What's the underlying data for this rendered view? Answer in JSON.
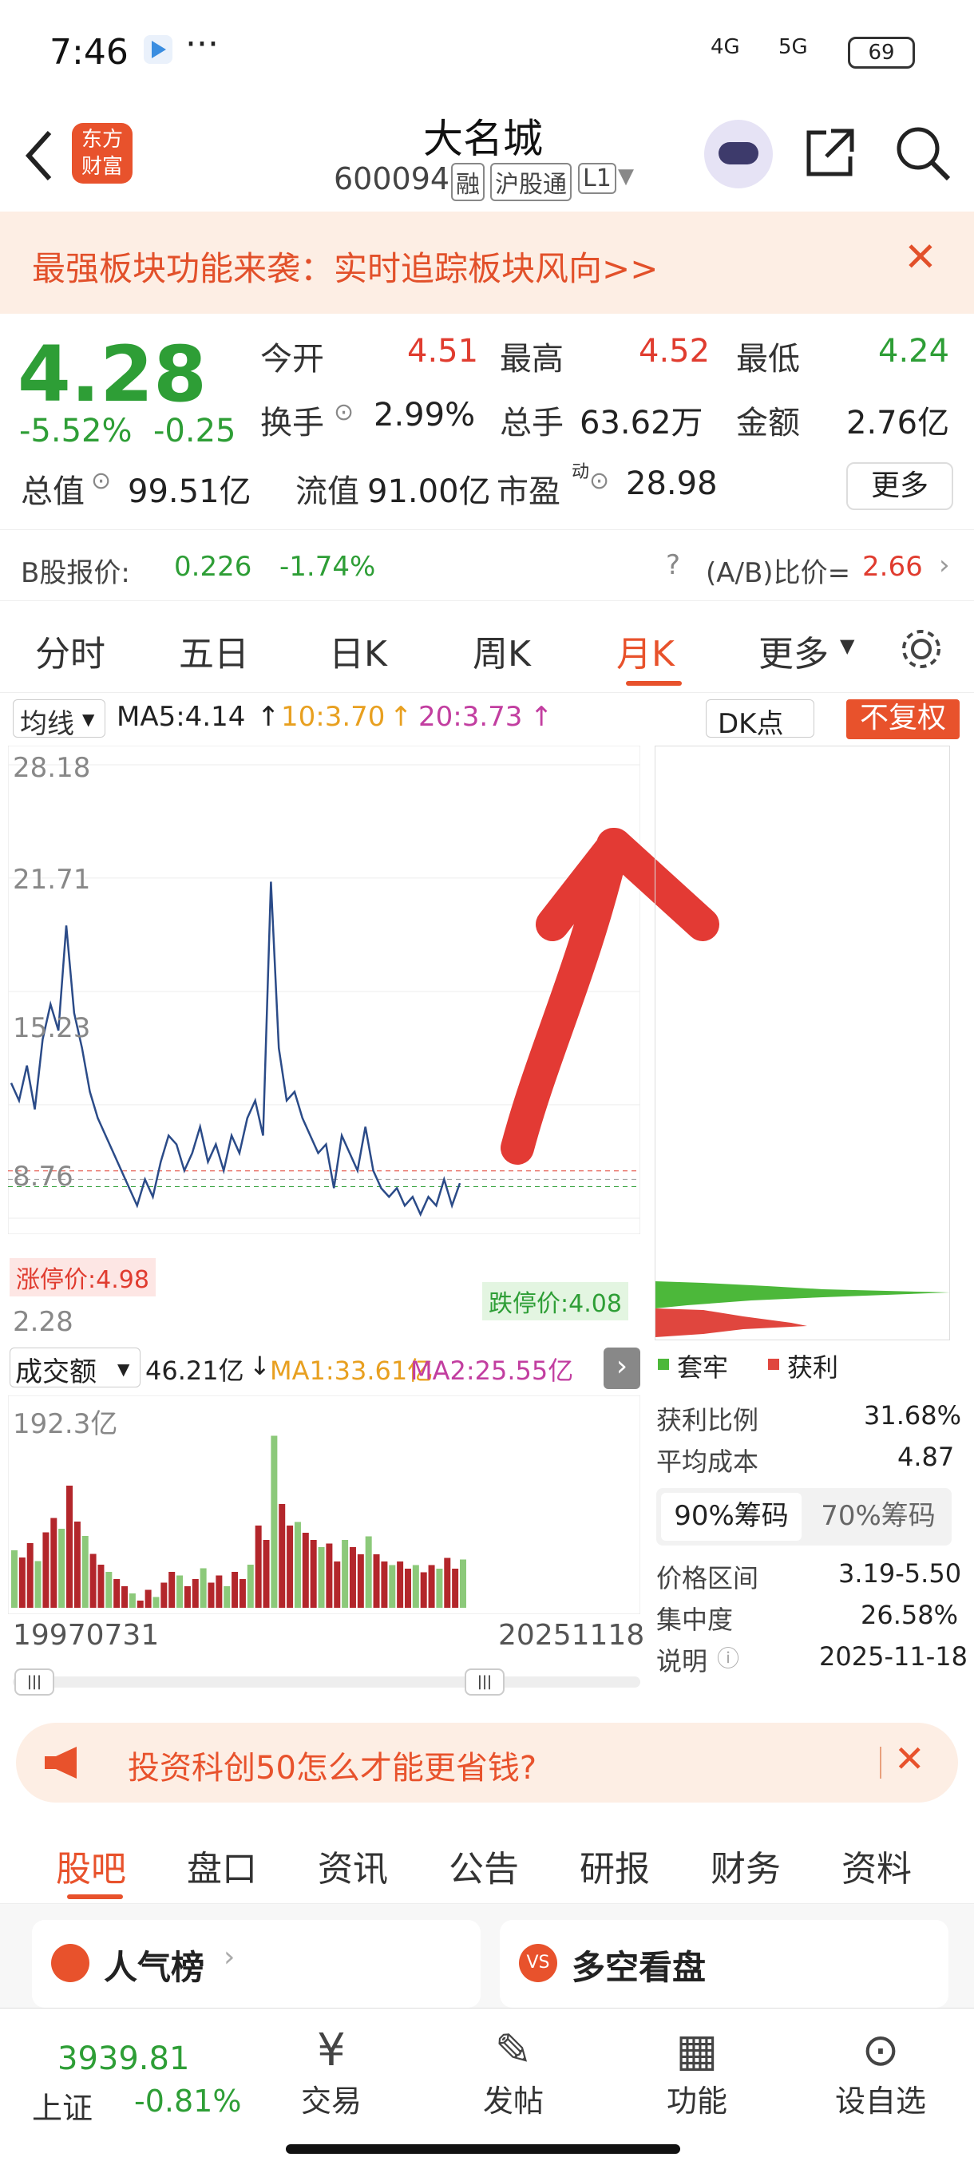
{
  "status": {
    "time": "7:46",
    "net1": "4G",
    "net2": "5G",
    "battery": "69"
  },
  "header": {
    "name": "大名城",
    "code": "600094",
    "tags": [
      "融",
      "沪股通",
      "L1"
    ]
  },
  "banner": {
    "text": "最强板块功能来袭：实时追踪板块风向>>"
  },
  "quote": {
    "price": "4.28",
    "change_pct": "-5.52%",
    "change": "-0.25",
    "open_label": "今开",
    "open": "4.51",
    "high_label": "最高",
    "high": "4.52",
    "low_label": "最低",
    "low": "4.24",
    "turnover_label": "换手",
    "turnover": "2.99%",
    "volume_label": "总手",
    "volume": "63.62万",
    "amount_label": "金额",
    "amount": "2.76亿",
    "mcap_label": "总值",
    "mcap": "99.51亿",
    "float_label": "流值",
    "float": "91.00亿",
    "pe_label": "市盈",
    "pe_sup": "动",
    "pe": "28.98",
    "more": "更多"
  },
  "bshare": {
    "label": "B股报价:",
    "price": "0.226",
    "pct": "-1.74%",
    "ratio_label": "(A/B)比价=",
    "ratio": "2.66"
  },
  "tabs": [
    "分时",
    "五日",
    "日K",
    "周K",
    "月K",
    "更多"
  ],
  "ma": {
    "sel": "均线",
    "ma5": "MA5:4.14",
    "ma10": "10:3.70",
    "ma20": "20:3.73",
    "dk": "DK点",
    "fq": "不复权"
  },
  "chart_data": {
    "type": "line",
    "ylim": [
      2.28,
      28.18
    ],
    "yticks": [
      "28.18",
      "21.71",
      "15.23",
      "8.76",
      "2.28"
    ],
    "x_start": "19970731",
    "x_end": "20251118",
    "limit_up": "涨停价:4.98",
    "limit_down": "跌停价:4.08",
    "vol_label": "成交额",
    "vol_now": "46.21亿",
    "vol_ma1": "MA1:33.61亿",
    "vol_ma2": "MA2:25.55亿",
    "vol_max": "192.3亿",
    "values": [
      10.0,
      9.0,
      11.0,
      8.5,
      12.5,
      14.5,
      13.0,
      19.0,
      14.0,
      12.0,
      9.5,
      8.0,
      7.0,
      6.0,
      5.0,
      4.0,
      3.0,
      4.5,
      3.5,
      5.5,
      7.0,
      6.5,
      5.0,
      6.0,
      7.5,
      5.5,
      6.5,
      5.0,
      7.0,
      6.0,
      8.0,
      9.0,
      7.0,
      21.5,
      12.0,
      9.0,
      9.5,
      8.0,
      7.0,
      6.0,
      6.5,
      4.0,
      7.0,
      6.0,
      5.0,
      7.5,
      5.0,
      4.0,
      3.5,
      4.0,
      3.0,
      3.5,
      2.5,
      3.5,
      3.0,
      4.5,
      3.0,
      4.28
    ]
  },
  "chips": {
    "legend_a": "套牢",
    "legend_b": "获利",
    "rows": [
      {
        "k": "获利比例",
        "v": "31.68%"
      },
      {
        "k": "平均成本",
        "v": "4.87"
      }
    ],
    "tab1": "90%筹码",
    "tab2": "70%筹码",
    "rows2": [
      {
        "k": "价格区间",
        "v": "3.19-5.50"
      },
      {
        "k": "集中度",
        "v": "26.58%"
      },
      {
        "k": "说明",
        "v": "2025-11-18"
      }
    ]
  },
  "ad": {
    "text": "投资科创50怎么才能更省钱?"
  },
  "bottom_tabs": [
    "股吧",
    "盘口",
    "资讯",
    "公告",
    "研报",
    "财务",
    "资料"
  ],
  "cards": {
    "c1": "人气榜",
    "c2": "多空看盘"
  },
  "nav": {
    "index_val": "3939.81",
    "index_name": "上证",
    "index_pct": "-0.81%",
    "items": [
      "交易",
      "发帖",
      "功能",
      "设自选"
    ]
  }
}
